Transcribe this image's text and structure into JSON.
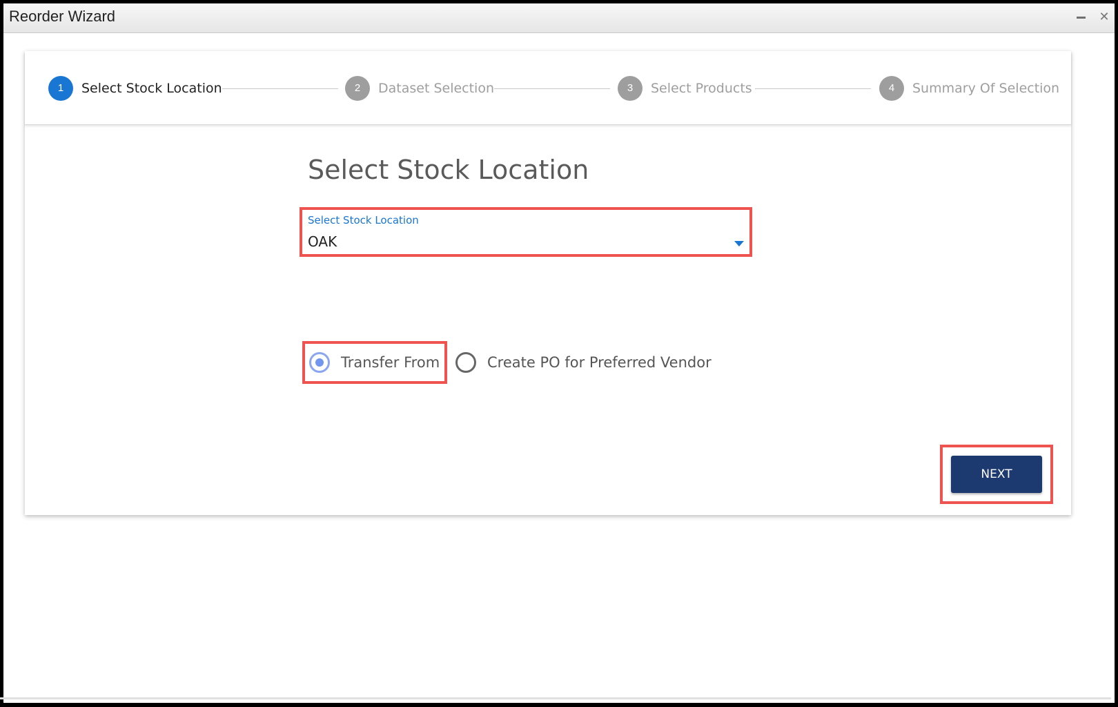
{
  "window": {
    "title": "Reorder Wizard"
  },
  "stepper": {
    "steps": [
      {
        "number": "1",
        "label": "Select Stock Location",
        "state": "active"
      },
      {
        "number": "2",
        "label": "Dataset Selection",
        "state": "inactive"
      },
      {
        "number": "3",
        "label": "Select Products",
        "state": "inactive"
      },
      {
        "number": "4",
        "label": "Summary Of Selection",
        "state": "inactive"
      }
    ]
  },
  "main": {
    "heading": "Select Stock Location",
    "stock_location_field": {
      "label": "Select Stock Location",
      "value": "OAK"
    },
    "transfer_options": [
      {
        "label": "Transfer From",
        "checked": true
      },
      {
        "label": "Create PO for Preferred Vendor",
        "checked": false
      }
    ],
    "next_label": "NEXT"
  },
  "colors": {
    "accent_blue": "#1976d2",
    "next_button": "#1d3a70",
    "highlight_frame": "#ef5350",
    "inactive_step": "#9e9e9e"
  },
  "icons": {
    "minimize": "minimize-icon",
    "close": "close-icon",
    "dropdown": "chevron-down-icon"
  }
}
